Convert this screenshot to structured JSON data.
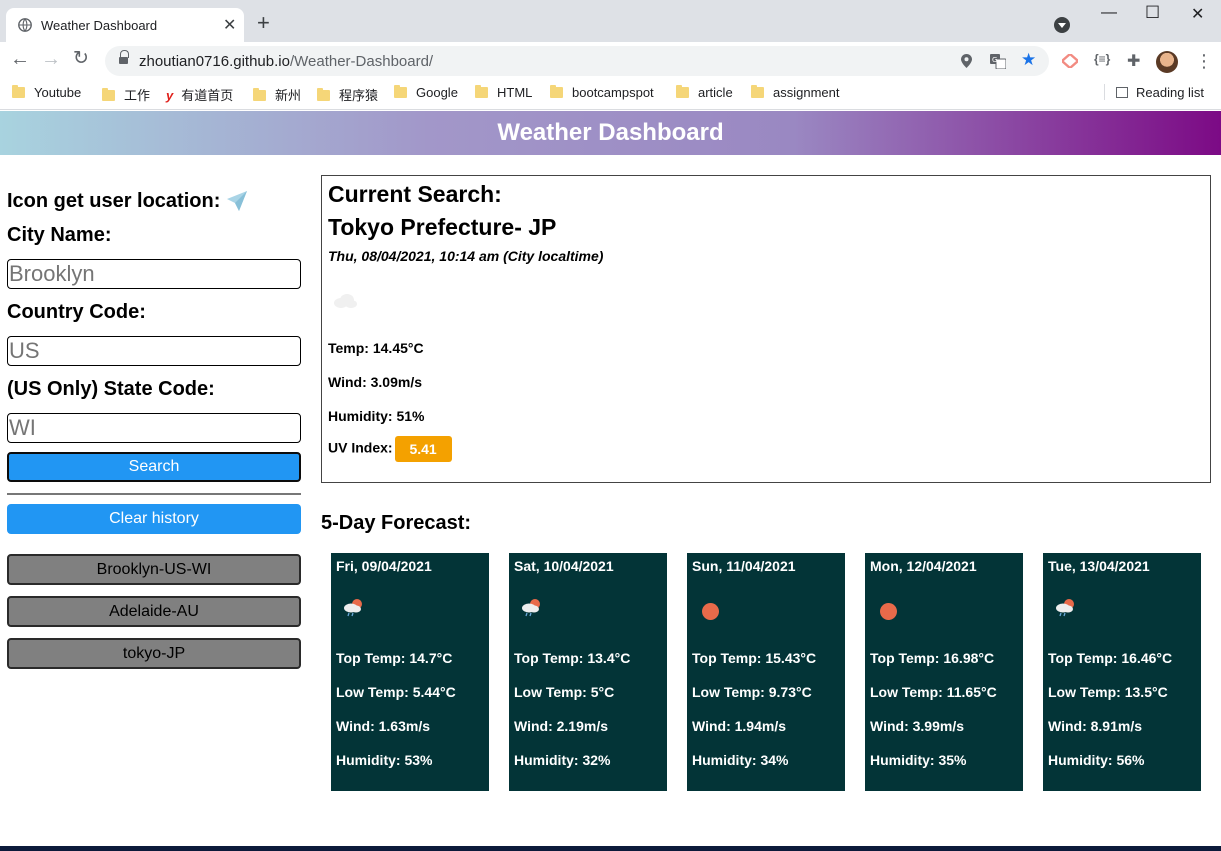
{
  "browser": {
    "tab_title": "Weather Dashboard",
    "url_host": "zhoutian0716.github.io",
    "url_path": "/Weather-Dashboard/",
    "bookmarks": [
      "Youtube",
      "工作",
      "有道首页",
      "新州",
      "程序猿",
      "Google",
      "HTML",
      "bootcampspot",
      "article",
      "assignment"
    ],
    "reading_list": "Reading list"
  },
  "header": {
    "title": "Weather Dashboard"
  },
  "sidebar": {
    "location_label": "Icon get user location:",
    "city_label": "City Name:",
    "city_placeholder": "Brooklyn",
    "country_label": "Country Code:",
    "country_placeholder": "US",
    "state_label": "(US Only) State Code:",
    "state_placeholder": "WI",
    "search_label": "Search",
    "clear_label": "Clear history",
    "history": [
      "Brooklyn-US-WI",
      "Adelaide-AU",
      "tokyo-JP"
    ]
  },
  "current": {
    "heading": "Current Search:",
    "city": "Tokyo Prefecture- JP",
    "datetime": "Thu, 08/04/2021, 10:14 am (City localtime)",
    "icon": "cloud-icon",
    "temp": "Temp: 14.45°C",
    "wind": "Wind: 3.09m/s",
    "humidity": "Humidity: 51%",
    "uv_label": "UV Index:",
    "uv_value": "5.41",
    "uv_color": "#f4a100"
  },
  "forecast": {
    "title": "5-Day Forecast:",
    "days": [
      {
        "date": "Fri, 09/04/2021",
        "icon": "sun-cloud-rain-icon",
        "top": "Top Temp: 14.7°C",
        "low": "Low Temp: 5.44°C",
        "wind": "Wind: 1.63m/s",
        "humidity": "Humidity: 53%"
      },
      {
        "date": "Sat, 10/04/2021",
        "icon": "sun-cloud-rain-icon",
        "top": "Top Temp: 13.4°C",
        "low": "Low Temp: 5°C",
        "wind": "Wind: 2.19m/s",
        "humidity": "Humidity: 32%"
      },
      {
        "date": "Sun, 11/04/2021",
        "icon": "sun-icon",
        "top": "Top Temp: 15.43°C",
        "low": "Low Temp: 9.73°C",
        "wind": "Wind: 1.94m/s",
        "humidity": "Humidity: 34%"
      },
      {
        "date": "Mon, 12/04/2021",
        "icon": "sun-icon",
        "top": "Top Temp: 16.98°C",
        "low": "Low Temp: 11.65°C",
        "wind": "Wind: 3.99m/s",
        "humidity": "Humidity: 35%"
      },
      {
        "date": "Tue, 13/04/2021",
        "icon": "sun-cloud-rain-icon",
        "top": "Top Temp: 16.46°C",
        "low": "Low Temp: 13.5°C",
        "wind": "Wind: 8.91m/s",
        "humidity": "Humidity: 56%"
      }
    ]
  },
  "colors": {
    "card_bg": "#033437",
    "button_blue": "#2196f3",
    "history_gray": "#808080",
    "sun": "#e86a4a"
  }
}
